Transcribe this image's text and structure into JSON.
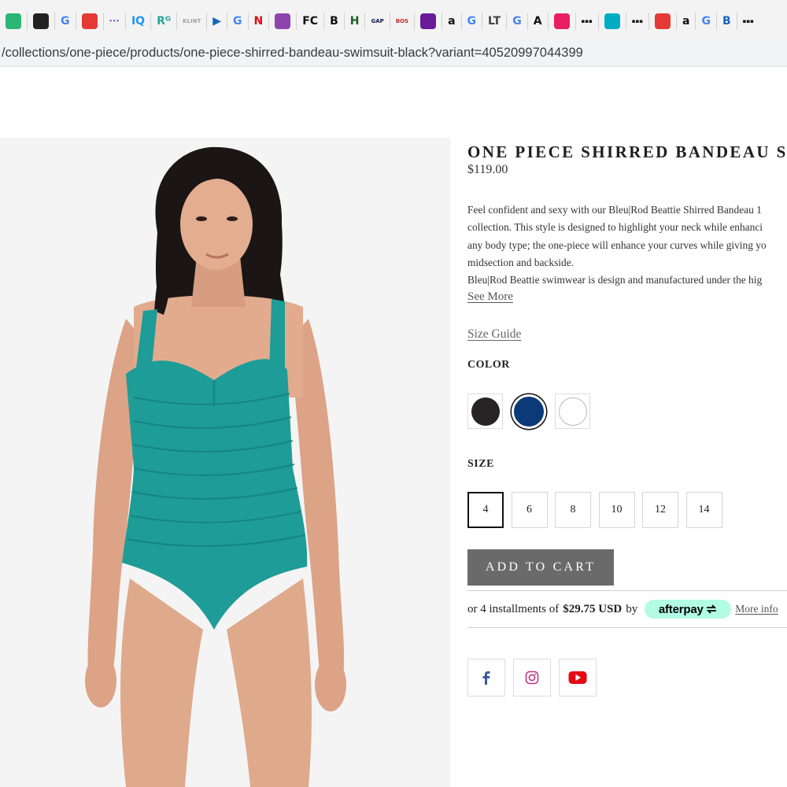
{
  "browser": {
    "bookmarks": [
      {
        "icon": "green-hat-icon",
        "color": "#2bb673",
        "text": ""
      },
      {
        "icon": "moneycontrol-icon",
        "color": "#222222",
        "text": ""
      },
      {
        "icon": "google-icon",
        "color": "#4285f4",
        "text": "G"
      },
      {
        "icon": "red-blue-a-icon",
        "color": "#e53935",
        "text": ""
      },
      {
        "icon": "dots-icon",
        "color": "#7e57c2",
        "text": "•••"
      },
      {
        "icon": "iq-icon",
        "color": "#2196f3",
        "text": "IQ"
      },
      {
        "icon": "rg-icon",
        "color": "#26a69a",
        "text": "Rᴳ"
      },
      {
        "icon": "klint-icon",
        "color": "#9e9e9e",
        "text": "KLINT"
      },
      {
        "icon": "play-icon",
        "color": "#1565c0",
        "text": "▶"
      },
      {
        "icon": "google-icon",
        "color": "#4285f4",
        "text": "G"
      },
      {
        "icon": "netflix-icon",
        "color": "#e50914",
        "text": "N"
      },
      {
        "icon": "gallery-icon",
        "color": "#8e44ad",
        "text": ""
      },
      {
        "icon": "fc-icon",
        "color": "#111111",
        "text": "FC"
      },
      {
        "icon": "bold-b-icon",
        "color": "#111111",
        "text": "B"
      },
      {
        "icon": "h-icon",
        "color": "#1b5e20",
        "text": "H"
      },
      {
        "icon": "gap-icon",
        "color": "#0d1b4c",
        "text": "GAP"
      },
      {
        "icon": "bos-icon",
        "color": "#c62828",
        "text": "BOS"
      },
      {
        "icon": "playlist-icon",
        "color": "#6a1b9a",
        "text": ""
      },
      {
        "icon": "amazon-icon",
        "color": "#111111",
        "text": "a"
      },
      {
        "icon": "google-icon",
        "color": "#4285f4",
        "text": "G"
      },
      {
        "icon": "lt-icon",
        "color": "#444444",
        "text": "LT"
      },
      {
        "icon": "google-icon",
        "color": "#4285f4",
        "text": "G"
      },
      {
        "icon": "a-serif-icon",
        "color": "#111111",
        "text": "A"
      },
      {
        "icon": "colored-dots-icon",
        "color": "#e91e63",
        "text": ""
      },
      {
        "icon": "three-bars-icon",
        "color": "#111111",
        "text": "▪▪▪"
      },
      {
        "icon": "swirl-icon",
        "color": "#00acc1",
        "text": ""
      },
      {
        "icon": "three-bars-icon",
        "color": "#111111",
        "text": "▪▪▪"
      },
      {
        "icon": "flag-icon",
        "color": "#e53935",
        "text": ""
      },
      {
        "icon": "amazon-icon",
        "color": "#111111",
        "text": "a"
      },
      {
        "icon": "google-icon",
        "color": "#4285f4",
        "text": "G"
      },
      {
        "icon": "b-box-icon",
        "color": "#1565c0",
        "text": "B"
      },
      {
        "icon": "three-bars-icon",
        "color": "#111111",
        "text": "▪▪▪"
      }
    ],
    "url": "/collections/one-piece/products/one-piece-shirred-bandeau-swimsuit-black?variant=40520997044399"
  },
  "product": {
    "title": "ONE PIECE SHIRRED BANDEAU SW",
    "price": "$119.00",
    "description_lines": [
      "Feel confident and sexy with our Bleu|Rod Beattie Shirred Bandeau 1",
      "collection. This style is designed to highlight your neck while enhanci",
      "any body type; the one-piece will enhance your curves while giving yo",
      "midsection and backside.",
      " Bleu|Rod Beattie swimwear is design and manufactured under the hig"
    ],
    "see_more": "See More",
    "size_guide": "Size Guide",
    "color_label": "COLOR",
    "colors": [
      {
        "name": "black",
        "hex": "#262424",
        "selected": false
      },
      {
        "name": "navy",
        "hex": "#0c3a78",
        "selected": true
      },
      {
        "name": "white",
        "hex": "#ffffff",
        "selected": false
      }
    ],
    "size_label": "SIZE",
    "sizes": [
      {
        "label": "4",
        "selected": true
      },
      {
        "label": "6",
        "selected": false
      },
      {
        "label": "8",
        "selected": false
      },
      {
        "label": "10",
        "selected": false
      },
      {
        "label": "12",
        "selected": false
      },
      {
        "label": "14",
        "selected": false
      }
    ],
    "add_to_cart": "ADD TO CART",
    "installments": {
      "prefix": "or 4 installments of",
      "amount": "$29.75 USD",
      "by": "by",
      "provider": "afterpay",
      "more_info": "More info"
    },
    "social": [
      {
        "icon": "facebook-icon",
        "color": "#3b5998"
      },
      {
        "icon": "instagram-icon",
        "color": "#c13584"
      },
      {
        "icon": "youtube-icon",
        "color": "#e50914"
      }
    ],
    "image": {
      "swimsuit_color": "#1e9c97",
      "background": "#f4f4f4"
    }
  }
}
